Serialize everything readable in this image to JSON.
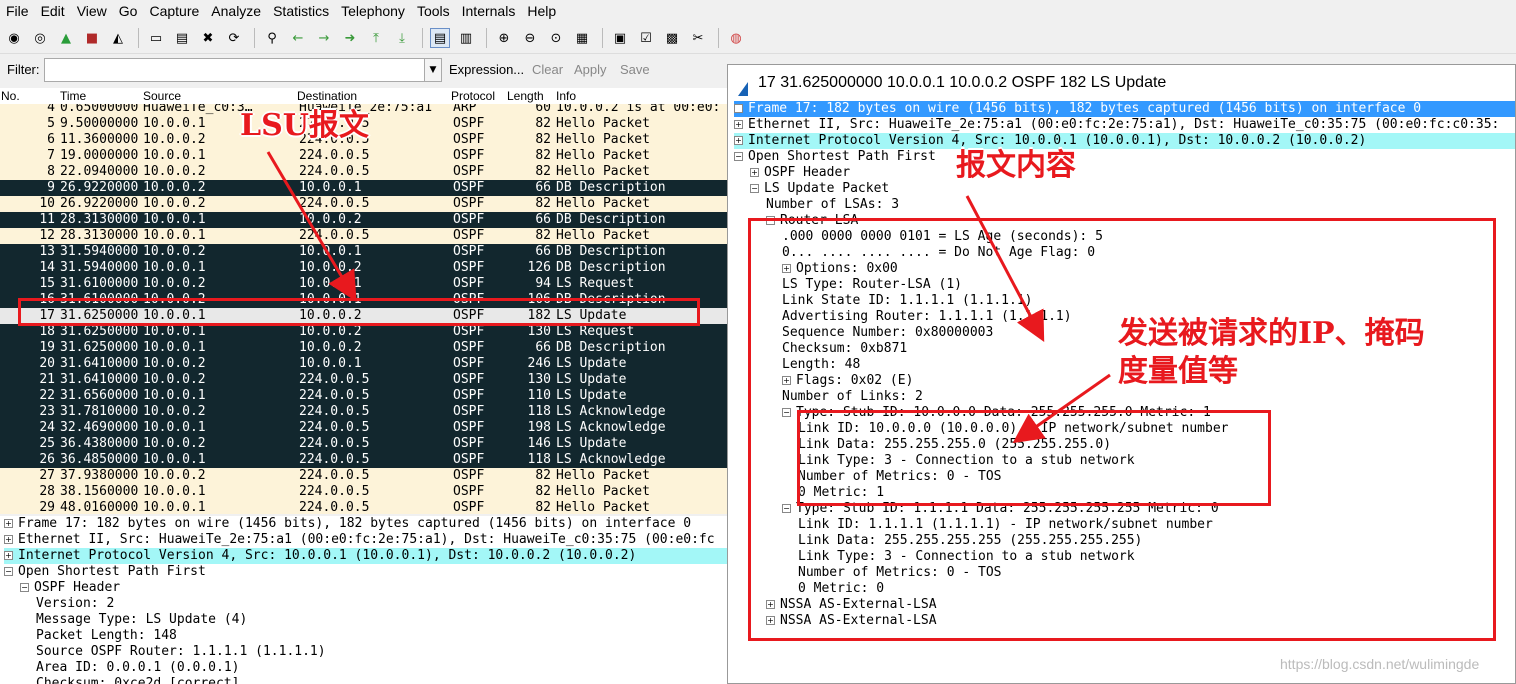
{
  "menu": [
    "File",
    "Edit",
    "View",
    "Go",
    "Capture",
    "Analyze",
    "Statistics",
    "Telephony",
    "Tools",
    "Internals",
    "Help"
  ],
  "filter": {
    "label": "Filter:",
    "value": "",
    "expression": "Expression...",
    "clear": "Clear",
    "apply": "Apply",
    "save": "Save"
  },
  "columns": {
    "no": "No.",
    "time": "Time",
    "source": "Source",
    "destination": "Destination",
    "protocol": "Protocol",
    "length": "Length",
    "info": "Info"
  },
  "packets": [
    {
      "no": "4",
      "time": "0.65000000",
      "src": "HuaweiTe_c0:3…",
      "dst": "HuaweiTe_2e:75:a1",
      "proto": "ARP",
      "len": "60",
      "info": "10.0.0.2 is at 00:e0:",
      "style": "light"
    },
    {
      "no": "5",
      "time": "9.50000000",
      "src": "10.0.0.1",
      "dst": "224.0.0.5",
      "proto": "OSPF",
      "len": "82",
      "info": "Hello Packet",
      "style": "light"
    },
    {
      "no": "6",
      "time": "11.3600000",
      "src": "10.0.0.2",
      "dst": "224.0.0.5",
      "proto": "OSPF",
      "len": "82",
      "info": "Hello Packet",
      "style": "light"
    },
    {
      "no": "7",
      "time": "19.0000000",
      "src": "10.0.0.1",
      "dst": "224.0.0.5",
      "proto": "OSPF",
      "len": "82",
      "info": "Hello Packet",
      "style": "light"
    },
    {
      "no": "8",
      "time": "22.0940000",
      "src": "10.0.0.2",
      "dst": "224.0.0.5",
      "proto": "OSPF",
      "len": "82",
      "info": "Hello Packet",
      "style": "light"
    },
    {
      "no": "9",
      "time": "26.9220000",
      "src": "10.0.0.2",
      "dst": "10.0.0.1",
      "proto": "OSPF",
      "len": "66",
      "info": "DB Description",
      "style": "dark"
    },
    {
      "no": "10",
      "time": "26.9220000",
      "src": "10.0.0.2",
      "dst": "224.0.0.5",
      "proto": "OSPF",
      "len": "82",
      "info": "Hello Packet",
      "style": "light"
    },
    {
      "no": "11",
      "time": "28.3130000",
      "src": "10.0.0.1",
      "dst": "10.0.0.2",
      "proto": "OSPF",
      "len": "66",
      "info": "DB Description",
      "style": "dark"
    },
    {
      "no": "12",
      "time": "28.3130000",
      "src": "10.0.0.1",
      "dst": "224.0.0.5",
      "proto": "OSPF",
      "len": "82",
      "info": "Hello Packet",
      "style": "light"
    },
    {
      "no": "13",
      "time": "31.5940000",
      "src": "10.0.0.2",
      "dst": "10.0.0.1",
      "proto": "OSPF",
      "len": "66",
      "info": "DB Description",
      "style": "dark"
    },
    {
      "no": "14",
      "time": "31.5940000",
      "src": "10.0.0.1",
      "dst": "10.0.0.2",
      "proto": "OSPF",
      "len": "126",
      "info": "DB Description",
      "style": "dark"
    },
    {
      "no": "15",
      "time": "31.6100000",
      "src": "10.0.0.2",
      "dst": "10.0.0.1",
      "proto": "OSPF",
      "len": "94",
      "info": "LS Request",
      "style": "dark"
    },
    {
      "no": "16",
      "time": "31.6100000",
      "src": "10.0.0.2",
      "dst": "10.0.0.1",
      "proto": "OSPF",
      "len": "106",
      "info": "DB Description",
      "style": "dark"
    },
    {
      "no": "17",
      "time": "31.6250000",
      "src": "10.0.0.1",
      "dst": "10.0.0.2",
      "proto": "OSPF",
      "len": "182",
      "info": "LS Update",
      "style": "sel"
    },
    {
      "no": "18",
      "time": "31.6250000",
      "src": "10.0.0.1",
      "dst": "10.0.0.2",
      "proto": "OSPF",
      "len": "130",
      "info": "LS Request",
      "style": "dark"
    },
    {
      "no": "19",
      "time": "31.6250000",
      "src": "10.0.0.1",
      "dst": "10.0.0.2",
      "proto": "OSPF",
      "len": "66",
      "info": "DB Description",
      "style": "dark"
    },
    {
      "no": "20",
      "time": "31.6410000",
      "src": "10.0.0.2",
      "dst": "10.0.0.1",
      "proto": "OSPF",
      "len": "246",
      "info": "LS Update",
      "style": "dark"
    },
    {
      "no": "21",
      "time": "31.6410000",
      "src": "10.0.0.2",
      "dst": "224.0.0.5",
      "proto": "OSPF",
      "len": "130",
      "info": "LS Update",
      "style": "dark"
    },
    {
      "no": "22",
      "time": "31.6560000",
      "src": "10.0.0.1",
      "dst": "224.0.0.5",
      "proto": "OSPF",
      "len": "110",
      "info": "LS Update",
      "style": "dark"
    },
    {
      "no": "23",
      "time": "31.7810000",
      "src": "10.0.0.2",
      "dst": "224.0.0.5",
      "proto": "OSPF",
      "len": "118",
      "info": "LS Acknowledge",
      "style": "dark"
    },
    {
      "no": "24",
      "time": "32.4690000",
      "src": "10.0.0.1",
      "dst": "224.0.0.5",
      "proto": "OSPF",
      "len": "198",
      "info": "LS Acknowledge",
      "style": "dark"
    },
    {
      "no": "25",
      "time": "36.4380000",
      "src": "10.0.0.2",
      "dst": "224.0.0.5",
      "proto": "OSPF",
      "len": "146",
      "info": "LS Update",
      "style": "dark"
    },
    {
      "no": "26",
      "time": "36.4850000",
      "src": "10.0.0.1",
      "dst": "224.0.0.5",
      "proto": "OSPF",
      "len": "118",
      "info": "LS Acknowledge",
      "style": "dark"
    },
    {
      "no": "27",
      "time": "37.9380000",
      "src": "10.0.0.2",
      "dst": "224.0.0.5",
      "proto": "OSPF",
      "len": "82",
      "info": "Hello Packet",
      "style": "light"
    },
    {
      "no": "28",
      "time": "38.1560000",
      "src": "10.0.0.1",
      "dst": "224.0.0.5",
      "proto": "OSPF",
      "len": "82",
      "info": "Hello Packet",
      "style": "light"
    },
    {
      "no": "29",
      "time": "48.0160000",
      "src": "10.0.0.1",
      "dst": "224.0.0.5",
      "proto": "OSPF",
      "len": "82",
      "info": "Hello Packet",
      "style": "light"
    }
  ],
  "bottom_tree": [
    {
      "indent": 0,
      "exp": "+",
      "text": "Frame 17: 182 bytes on wire (1456 bits), 182 bytes captured (1456 bits) on interface 0",
      "hl": ""
    },
    {
      "indent": 0,
      "exp": "+",
      "text": "Ethernet II, Src: HuaweiTe_2e:75:a1 (00:e0:fc:2e:75:a1), Dst: HuaweiTe_c0:35:75 (00:e0:fc",
      "hl": ""
    },
    {
      "indent": 0,
      "exp": "+",
      "text": "Internet Protocol Version 4, Src: 10.0.0.1 (10.0.0.1), Dst: 10.0.0.2 (10.0.0.2)",
      "hl": "cyan"
    },
    {
      "indent": 0,
      "exp": "-",
      "text": "Open Shortest Path First",
      "hl": ""
    },
    {
      "indent": 1,
      "exp": "-",
      "text": "OSPF Header",
      "hl": ""
    },
    {
      "indent": 2,
      "exp": "",
      "text": "Version: 2",
      "hl": ""
    },
    {
      "indent": 2,
      "exp": "",
      "text": "Message Type: LS Update (4)",
      "hl": ""
    },
    {
      "indent": 2,
      "exp": "",
      "text": "Packet Length: 148",
      "hl": ""
    },
    {
      "indent": 2,
      "exp": "",
      "text": "Source OSPF Router: 1.1.1.1 (1.1.1.1)",
      "hl": ""
    },
    {
      "indent": 2,
      "exp": "",
      "text": "Area ID: 0.0.0.1 (0.0.0.1)",
      "hl": ""
    },
    {
      "indent": 2,
      "exp": "",
      "text": "Checksum: 0xce2d [correct]",
      "hl": ""
    }
  ],
  "detail": {
    "title": "17 31.625000000 10.0.0.1 10.0.0.2 OSPF 182 LS Update",
    "tree": [
      {
        "indent": 0,
        "exp": "+",
        "text": "Frame 17: 182 bytes on wire (1456 bits), 182 bytes captured (1456 bits) on interface 0",
        "hl": "blue"
      },
      {
        "indent": 0,
        "exp": "+",
        "text": "Ethernet II, Src: HuaweiTe_2e:75:a1 (00:e0:fc:2e:75:a1), Dst: HuaweiTe_c0:35:75 (00:e0:fc:c0:35:",
        "hl": ""
      },
      {
        "indent": 0,
        "exp": "+",
        "text": "Internet Protocol Version 4, Src: 10.0.0.1 (10.0.0.1), Dst: 10.0.0.2 (10.0.0.2)",
        "hl": "cyan"
      },
      {
        "indent": 0,
        "exp": "-",
        "text": "Open Shortest Path First",
        "hl": ""
      },
      {
        "indent": 1,
        "exp": "+",
        "text": "OSPF Header",
        "hl": ""
      },
      {
        "indent": 1,
        "exp": "-",
        "text": "LS Update Packet",
        "hl": ""
      },
      {
        "indent": 2,
        "exp": "",
        "text": "Number of LSAs: 3",
        "hl": ""
      },
      {
        "indent": 2,
        "exp": "-",
        "text": "Router-LSA",
        "hl": ""
      },
      {
        "indent": 3,
        "exp": "",
        "text": ".000 0000 0000 0101 = LS Age (seconds): 5",
        "hl": ""
      },
      {
        "indent": 3,
        "exp": "",
        "text": "0... .... .... .... = Do Not Age Flag: 0",
        "hl": ""
      },
      {
        "indent": 3,
        "exp": "+",
        "text": "Options: 0x00",
        "hl": ""
      },
      {
        "indent": 3,
        "exp": "",
        "text": "LS Type: Router-LSA (1)",
        "hl": ""
      },
      {
        "indent": 3,
        "exp": "",
        "text": "Link State ID: 1.1.1.1 (1.1.1.1)",
        "hl": ""
      },
      {
        "indent": 3,
        "exp": "",
        "text": "Advertising Router: 1.1.1.1 (1.1.1.1)",
        "hl": ""
      },
      {
        "indent": 3,
        "exp": "",
        "text": "Sequence Number: 0x80000003",
        "hl": ""
      },
      {
        "indent": 3,
        "exp": "",
        "text": "Checksum: 0xb871",
        "hl": ""
      },
      {
        "indent": 3,
        "exp": "",
        "text": "Length: 48",
        "hl": ""
      },
      {
        "indent": 3,
        "exp": "+",
        "text": "Flags: 0x02 (E)",
        "hl": ""
      },
      {
        "indent": 3,
        "exp": "",
        "text": "Number of Links: 2",
        "hl": ""
      },
      {
        "indent": 3,
        "exp": "-",
        "text": "Type: Stub     ID: 10.0.0.0        Data: 255.255.255.0   Metric: 1",
        "hl": ""
      },
      {
        "indent": 4,
        "exp": "",
        "text": "Link ID: 10.0.0.0 (10.0.0.0) - IP network/subnet number",
        "hl": ""
      },
      {
        "indent": 4,
        "exp": "",
        "text": "Link Data: 255.255.255.0 (255.255.255.0)",
        "hl": ""
      },
      {
        "indent": 4,
        "exp": "",
        "text": "Link Type: 3 - Connection to a stub network",
        "hl": ""
      },
      {
        "indent": 4,
        "exp": "",
        "text": "Number of Metrics: 0 - TOS",
        "hl": ""
      },
      {
        "indent": 4,
        "exp": "",
        "text": "0 Metric: 1",
        "hl": ""
      },
      {
        "indent": 3,
        "exp": "-",
        "text": "Type: Stub     ID: 1.1.1.1         Data: 255.255.255.255 Metric: 0",
        "hl": ""
      },
      {
        "indent": 4,
        "exp": "",
        "text": "Link ID: 1.1.1.1 (1.1.1.1) - IP network/subnet number",
        "hl": ""
      },
      {
        "indent": 4,
        "exp": "",
        "text": "Link Data: 255.255.255.255 (255.255.255.255)",
        "hl": ""
      },
      {
        "indent": 4,
        "exp": "",
        "text": "Link Type: 3 - Connection to a stub network",
        "hl": ""
      },
      {
        "indent": 4,
        "exp": "",
        "text": "Number of Metrics: 0 - TOS",
        "hl": ""
      },
      {
        "indent": 4,
        "exp": "",
        "text": "0 Metric: 0",
        "hl": ""
      },
      {
        "indent": 2,
        "exp": "+",
        "text": "NSSA AS-External-LSA",
        "hl": ""
      },
      {
        "indent": 2,
        "exp": "+",
        "text": "NSSA AS-External-LSA",
        "hl": ""
      }
    ]
  },
  "annotations": {
    "lsu": "LSU报文",
    "content": "报文内容",
    "sent_line1": "发送被请求的IP、掩码",
    "sent_line2": "度量值等"
  },
  "watermark": "https://blog.csdn.net/wulimingde",
  "colors": {
    "annotation": "#e8191e",
    "dark_row": "#12272e",
    "light_row": "#fdf3d9",
    "selected_blue": "#3399ff",
    "ip_cyan": "#a3f7f7"
  }
}
